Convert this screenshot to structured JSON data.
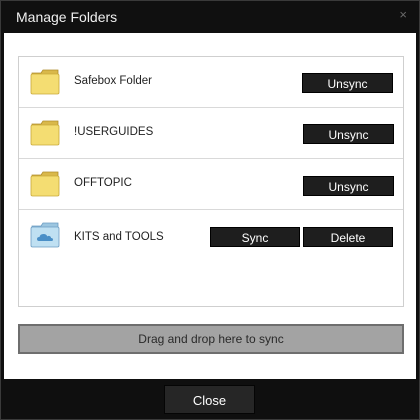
{
  "window": {
    "title": "Manage Folders",
    "close_glyph": "×"
  },
  "folders": [
    {
      "name": "Safebox Folder",
      "icon": "yellow-folder-icon",
      "actions": [
        "Unsync"
      ]
    },
    {
      "name": "!USERGUIDES",
      "icon": "yellow-folder-icon",
      "actions": [
        "Unsync"
      ]
    },
    {
      "name": "OFFTOPIC",
      "icon": "yellow-folder-icon",
      "actions": [
        "Unsync"
      ]
    },
    {
      "name": "KITS and TOOLS",
      "icon": "cloud-folder-icon",
      "actions": [
        "Sync",
        "Delete"
      ]
    }
  ],
  "dropzone": {
    "label": "Drag and drop here to sync"
  },
  "footer": {
    "close_label": "Close"
  },
  "colors": {
    "folder_yellow": "#f4dd72",
    "folder_yellow_dark": "#c9a93a",
    "cloud_folder": "#bfe0f2",
    "cloud_folder_dark": "#6b9cc2",
    "cloud": "#4a8fc7"
  }
}
